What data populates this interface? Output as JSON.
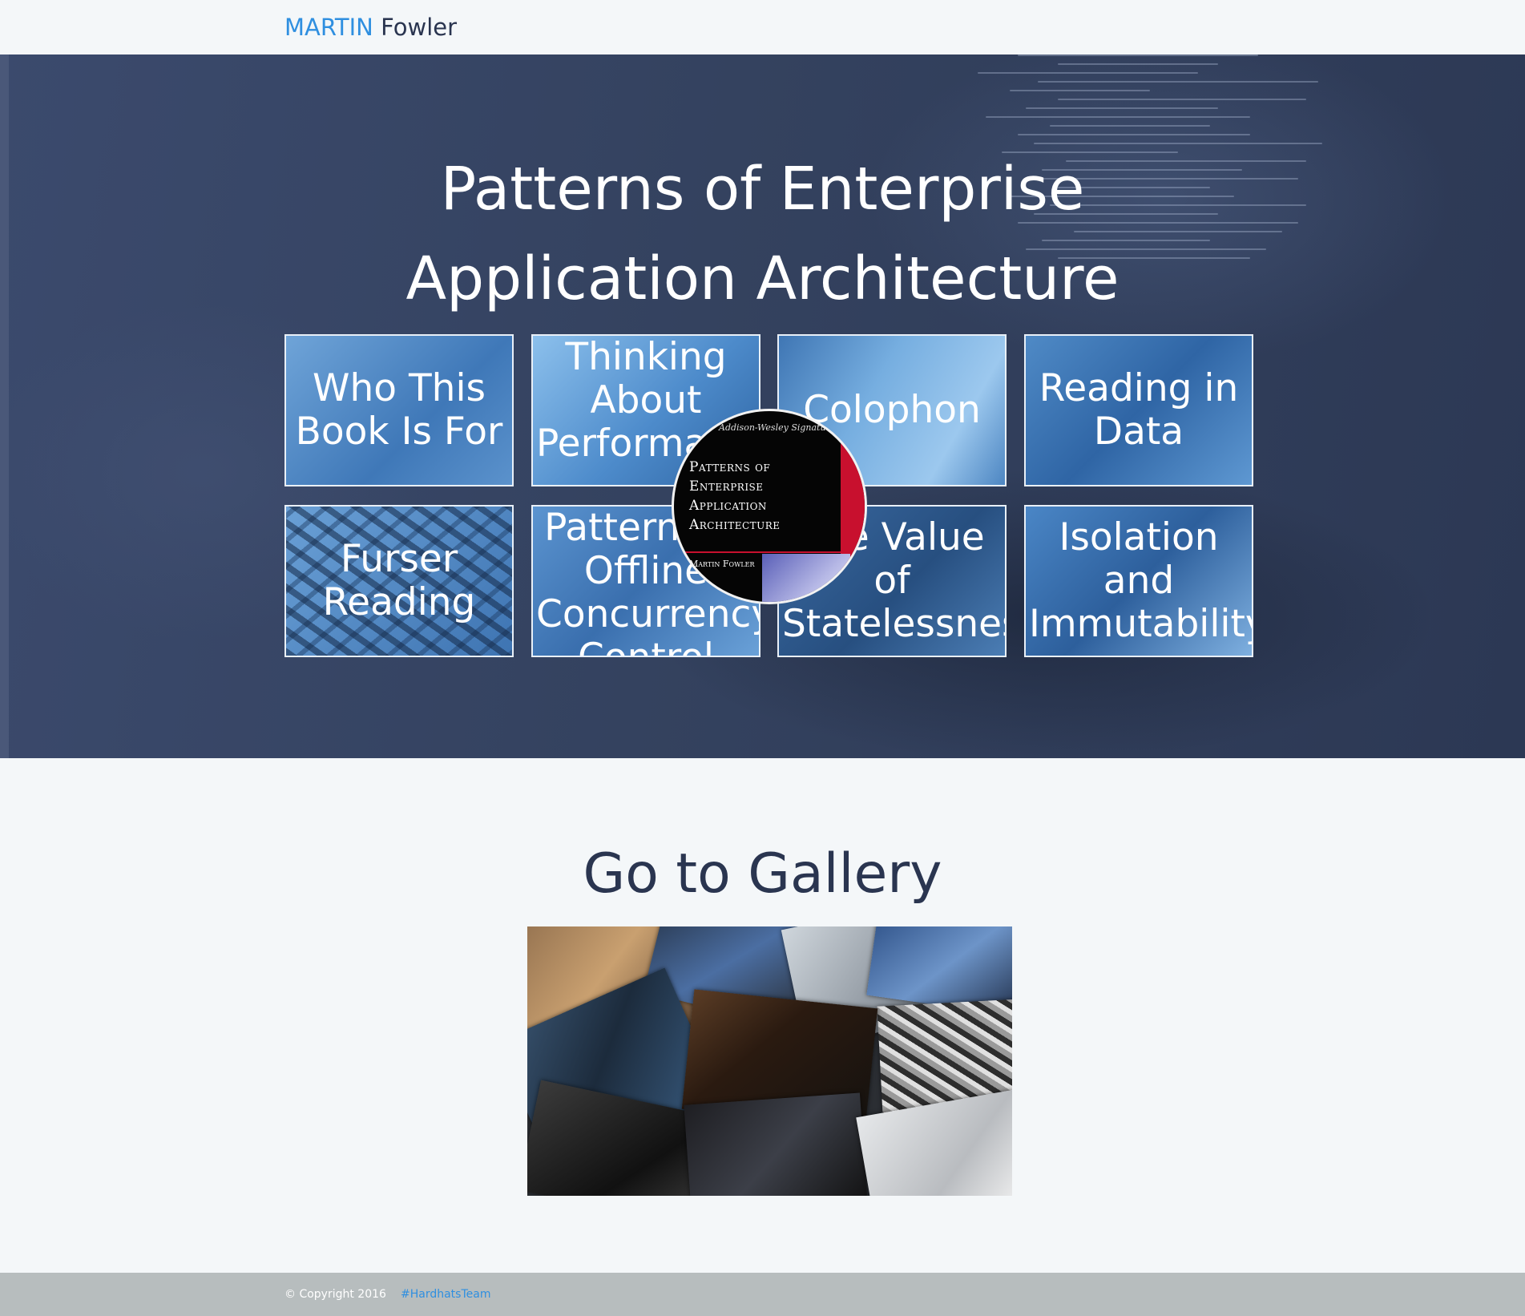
{
  "header": {
    "brand_first": "MARTIN",
    "brand_last": "Fowler"
  },
  "hero": {
    "title_line1": "Patterns of Enterprise",
    "title_line2": "Application Architecture",
    "tiles": [
      {
        "label": "Who This Book Is For"
      },
      {
        "label": "Thinking About Performance"
      },
      {
        "label": "Colophon"
      },
      {
        "label": "Reading in Data"
      },
      {
        "label": "Furser Reading"
      },
      {
        "label": "Patterns of Offline Concurrency Control"
      },
      {
        "label": "The Value of Statelessness"
      },
      {
        "label": "Isolation and Immutability"
      }
    ],
    "cover": {
      "series": "Addison-Wesley Signature Series",
      "title_lines": [
        "Patterns of",
        "Enterprise",
        "Application",
        "Architecture"
      ],
      "author": "Martin Fowler",
      "colors": {
        "background": "#050505",
        "accent": "#c8102e"
      }
    }
  },
  "gallery": {
    "title": "Go to Gallery"
  },
  "footer": {
    "copyright": "© Copyright 2016",
    "hashtag": "#HardhatsTeam"
  },
  "colors": {
    "brand_accent": "#2f8fe0",
    "text_dark": "#2a3550",
    "hero_bg": "#34425f",
    "footer_bg": "#b7bdbe"
  }
}
